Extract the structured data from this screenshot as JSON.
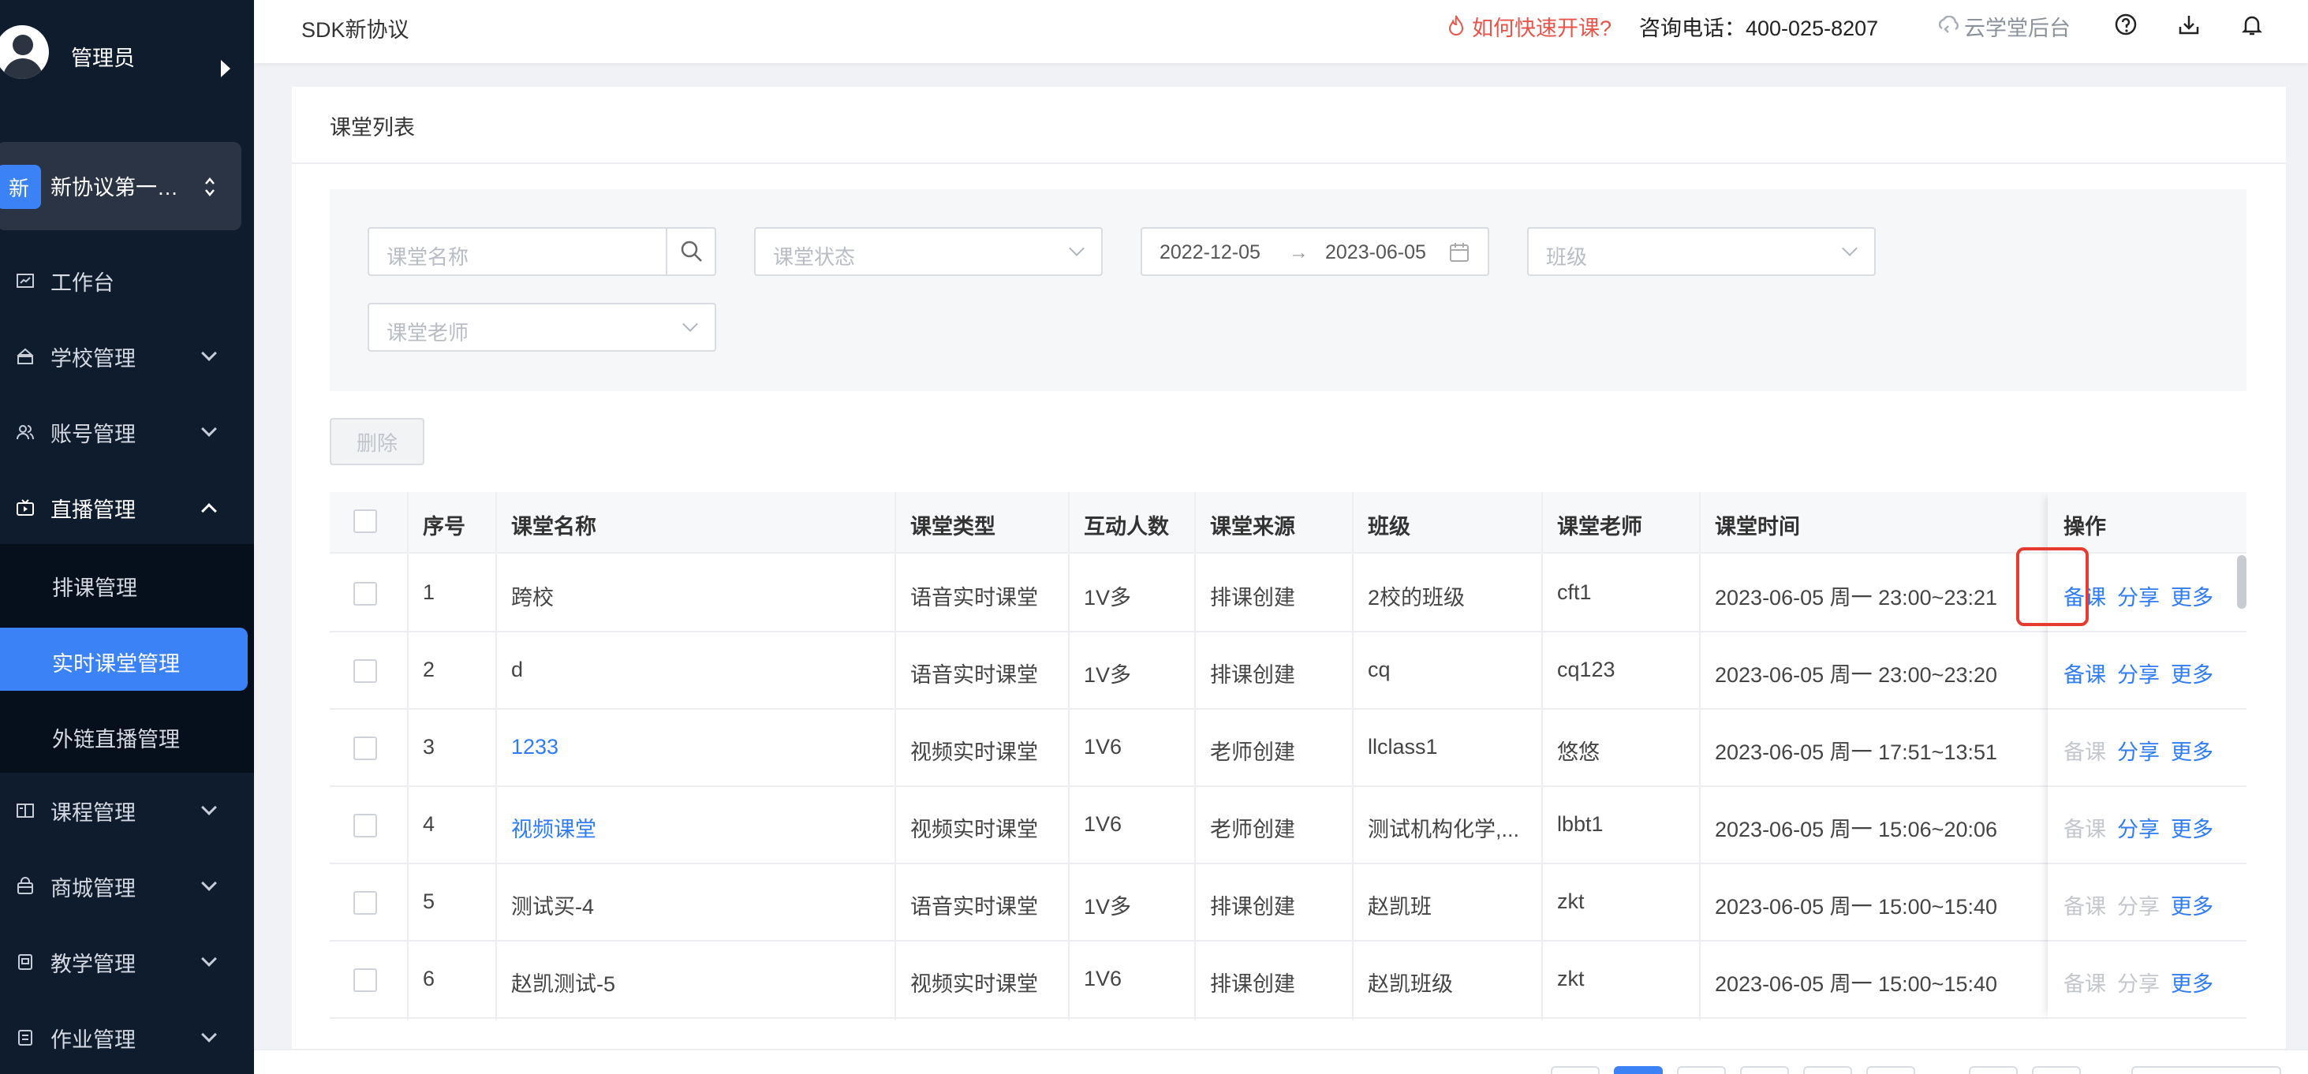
{
  "sidebar": {
    "user_name": "管理员",
    "school_badge": "新",
    "school_name": "新协议第一…",
    "menu": {
      "workbench": "工作台",
      "school": "学校管理",
      "account": "账号管理",
      "live": "直播管理",
      "live_sub": [
        "排课管理",
        "实时课堂管理",
        "外链直播管理"
      ],
      "course": "课程管理",
      "mall": "商城管理",
      "teaching": "教学管理",
      "homework": "作业管理"
    },
    "selected_sub": "实时课堂管理"
  },
  "header": {
    "title": "SDK新协议",
    "help_link": "如何快速开课?",
    "phone": "咨询电话：400-025-8207",
    "cloud_admin": "云学堂后台"
  },
  "card": {
    "title": "课堂列表"
  },
  "filters": {
    "name_placeholder": "课堂名称",
    "status_placeholder": "课堂状态",
    "date_start": "2022-12-05",
    "date_arrow": "→",
    "date_end": "2023-06-05",
    "class_placeholder": "班级",
    "teacher_placeholder": "课堂老师"
  },
  "actions": {
    "delete": "删除"
  },
  "table": {
    "headers": [
      "序号",
      "课堂名称",
      "课堂类型",
      "互动人数",
      "课堂来源",
      "班级",
      "课堂老师",
      "课堂时间",
      "操作"
    ],
    "rows": [
      {
        "no": "1",
        "name": "跨校",
        "type": "语音实时课堂",
        "count": "1V多",
        "source": "排课创建",
        "class": "2校的班级",
        "teacher": "cft1",
        "time": "2023-06-05 周一 23:00~23:21",
        "prep": "备课",
        "share": "分享",
        "more": "更多"
      },
      {
        "no": "2",
        "name": "d",
        "type": "语音实时课堂",
        "count": "1V多",
        "source": "排课创建",
        "class": "cq",
        "teacher": "cq123",
        "time": "2023-06-05 周一 23:00~23:20",
        "prep": "备课",
        "share": "分享",
        "more": "更多"
      },
      {
        "no": "3",
        "name": "1233",
        "type": "视频实时课堂",
        "count": "1V6",
        "source": "老师创建",
        "class": "llclass1",
        "teacher": "悠悠",
        "time": "2023-06-05 周一 17:51~13:51",
        "prep": "备课",
        "share": "分享",
        "more": "更多"
      },
      {
        "no": "4",
        "name": "视频课堂",
        "type": "视频实时课堂",
        "count": "1V6",
        "source": "老师创建",
        "class": "测试机构化学,...",
        "teacher": "lbbt1",
        "time": "2023-06-05 周一 15:06~20:06",
        "prep": "备课",
        "share": "分享",
        "more": "更多"
      },
      {
        "no": "5",
        "name": "测试买-4",
        "type": "语音实时课堂",
        "count": "1V多",
        "source": "排课创建",
        "class": "赵凯班",
        "teacher": "zkt",
        "time": "2023-06-05 周一 15:00~15:40",
        "prep": "备课",
        "share": "分享",
        "more": "更多"
      },
      {
        "no": "6",
        "name": "赵凯测试-5",
        "type": "视频实时课堂",
        "count": "1V6",
        "source": "排课创建",
        "class": "赵凯班级",
        "teacher": "zkt",
        "time": "2023-06-05 周一 15:00~15:40",
        "prep": "备课",
        "share": "分享",
        "more": "更多"
      }
    ]
  },
  "colors": {
    "sidebar_bg": "#0f1c2e",
    "accent": "#3b82f6",
    "link": "#2f7cf6",
    "help_red": "#e8534a",
    "highlight_red": "#e63b2e"
  }
}
